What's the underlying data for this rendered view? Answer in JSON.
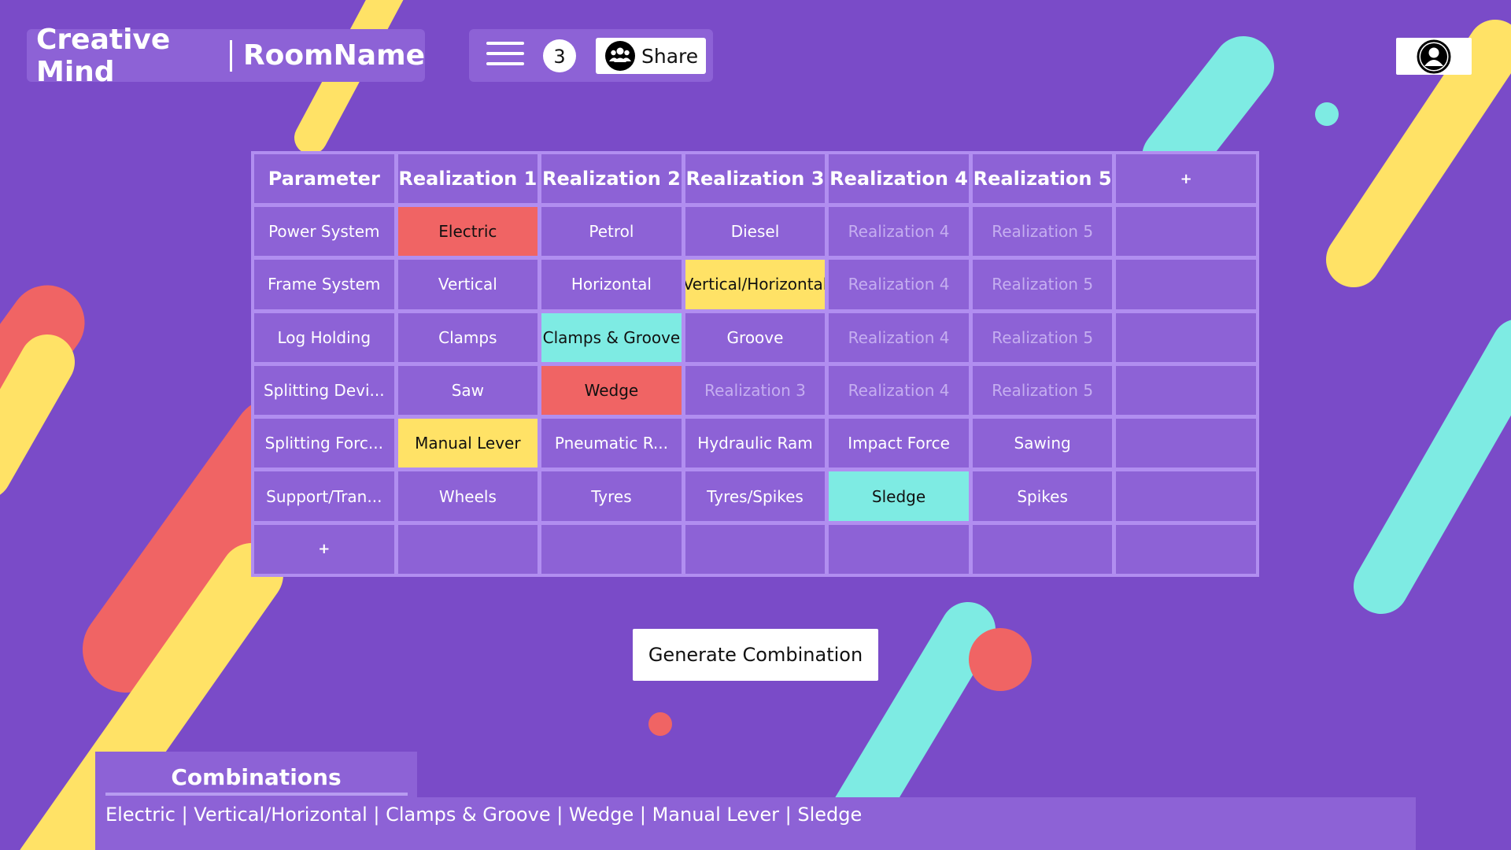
{
  "header": {
    "app_name": "Creative Mind",
    "room_name": "RoomName",
    "participants_count": "3",
    "share_label": "Share"
  },
  "icons": {
    "menu": "hamburger-menu-icon",
    "share": "group-icon",
    "profile": "user-avatar-icon"
  },
  "colors": {
    "background": "#7a4bc8",
    "panel": "#8d62d6",
    "red": "#f06464",
    "yellow": "#ffe266",
    "cyan": "#7eebe3"
  },
  "matrix": {
    "headers": [
      "Parameter",
      "Realization 1",
      "Realization 2",
      "Realization 3",
      "Realization 4",
      "Realization 5",
      "+"
    ],
    "rows": [
      {
        "cells": [
          "Power System",
          "Electric",
          "Petrol",
          "Diesel",
          "Realization 4",
          "Realization 5",
          ""
        ]
      },
      {
        "cells": [
          "Frame System",
          "Vertical",
          "Horizontal",
          "Vertical/Horizontal",
          "Realization 4",
          "Realization 5",
          ""
        ]
      },
      {
        "cells": [
          "Log Holding",
          "Clamps",
          "Clamps & Groove",
          "Groove",
          "Realization 4",
          "Realization 5",
          ""
        ]
      },
      {
        "cells": [
          "Splitting Devi...",
          "Saw",
          "Wedge",
          "Realization 3",
          "Realization 4",
          "Realization 5",
          ""
        ]
      },
      {
        "cells": [
          "Splitting Forc...",
          "Manual Lever",
          "Pneumatic R...",
          "Hydraulic Ram",
          "Impact Force",
          "Sawing",
          ""
        ]
      },
      {
        "cells": [
          "Support/Tran...",
          "Wheels",
          "Tyres",
          "Tyres/Spikes",
          "Sledge",
          "Spikes",
          ""
        ]
      },
      {
        "cells": [
          "+",
          "",
          "",
          "",
          "",
          "",
          ""
        ]
      }
    ]
  },
  "generate_label": "Generate Combination",
  "combinations": {
    "title": "Combinations",
    "result": "Electric | Vertical/Horizontal | Clamps & Groove | Wedge | Manual Lever | Sledge"
  }
}
